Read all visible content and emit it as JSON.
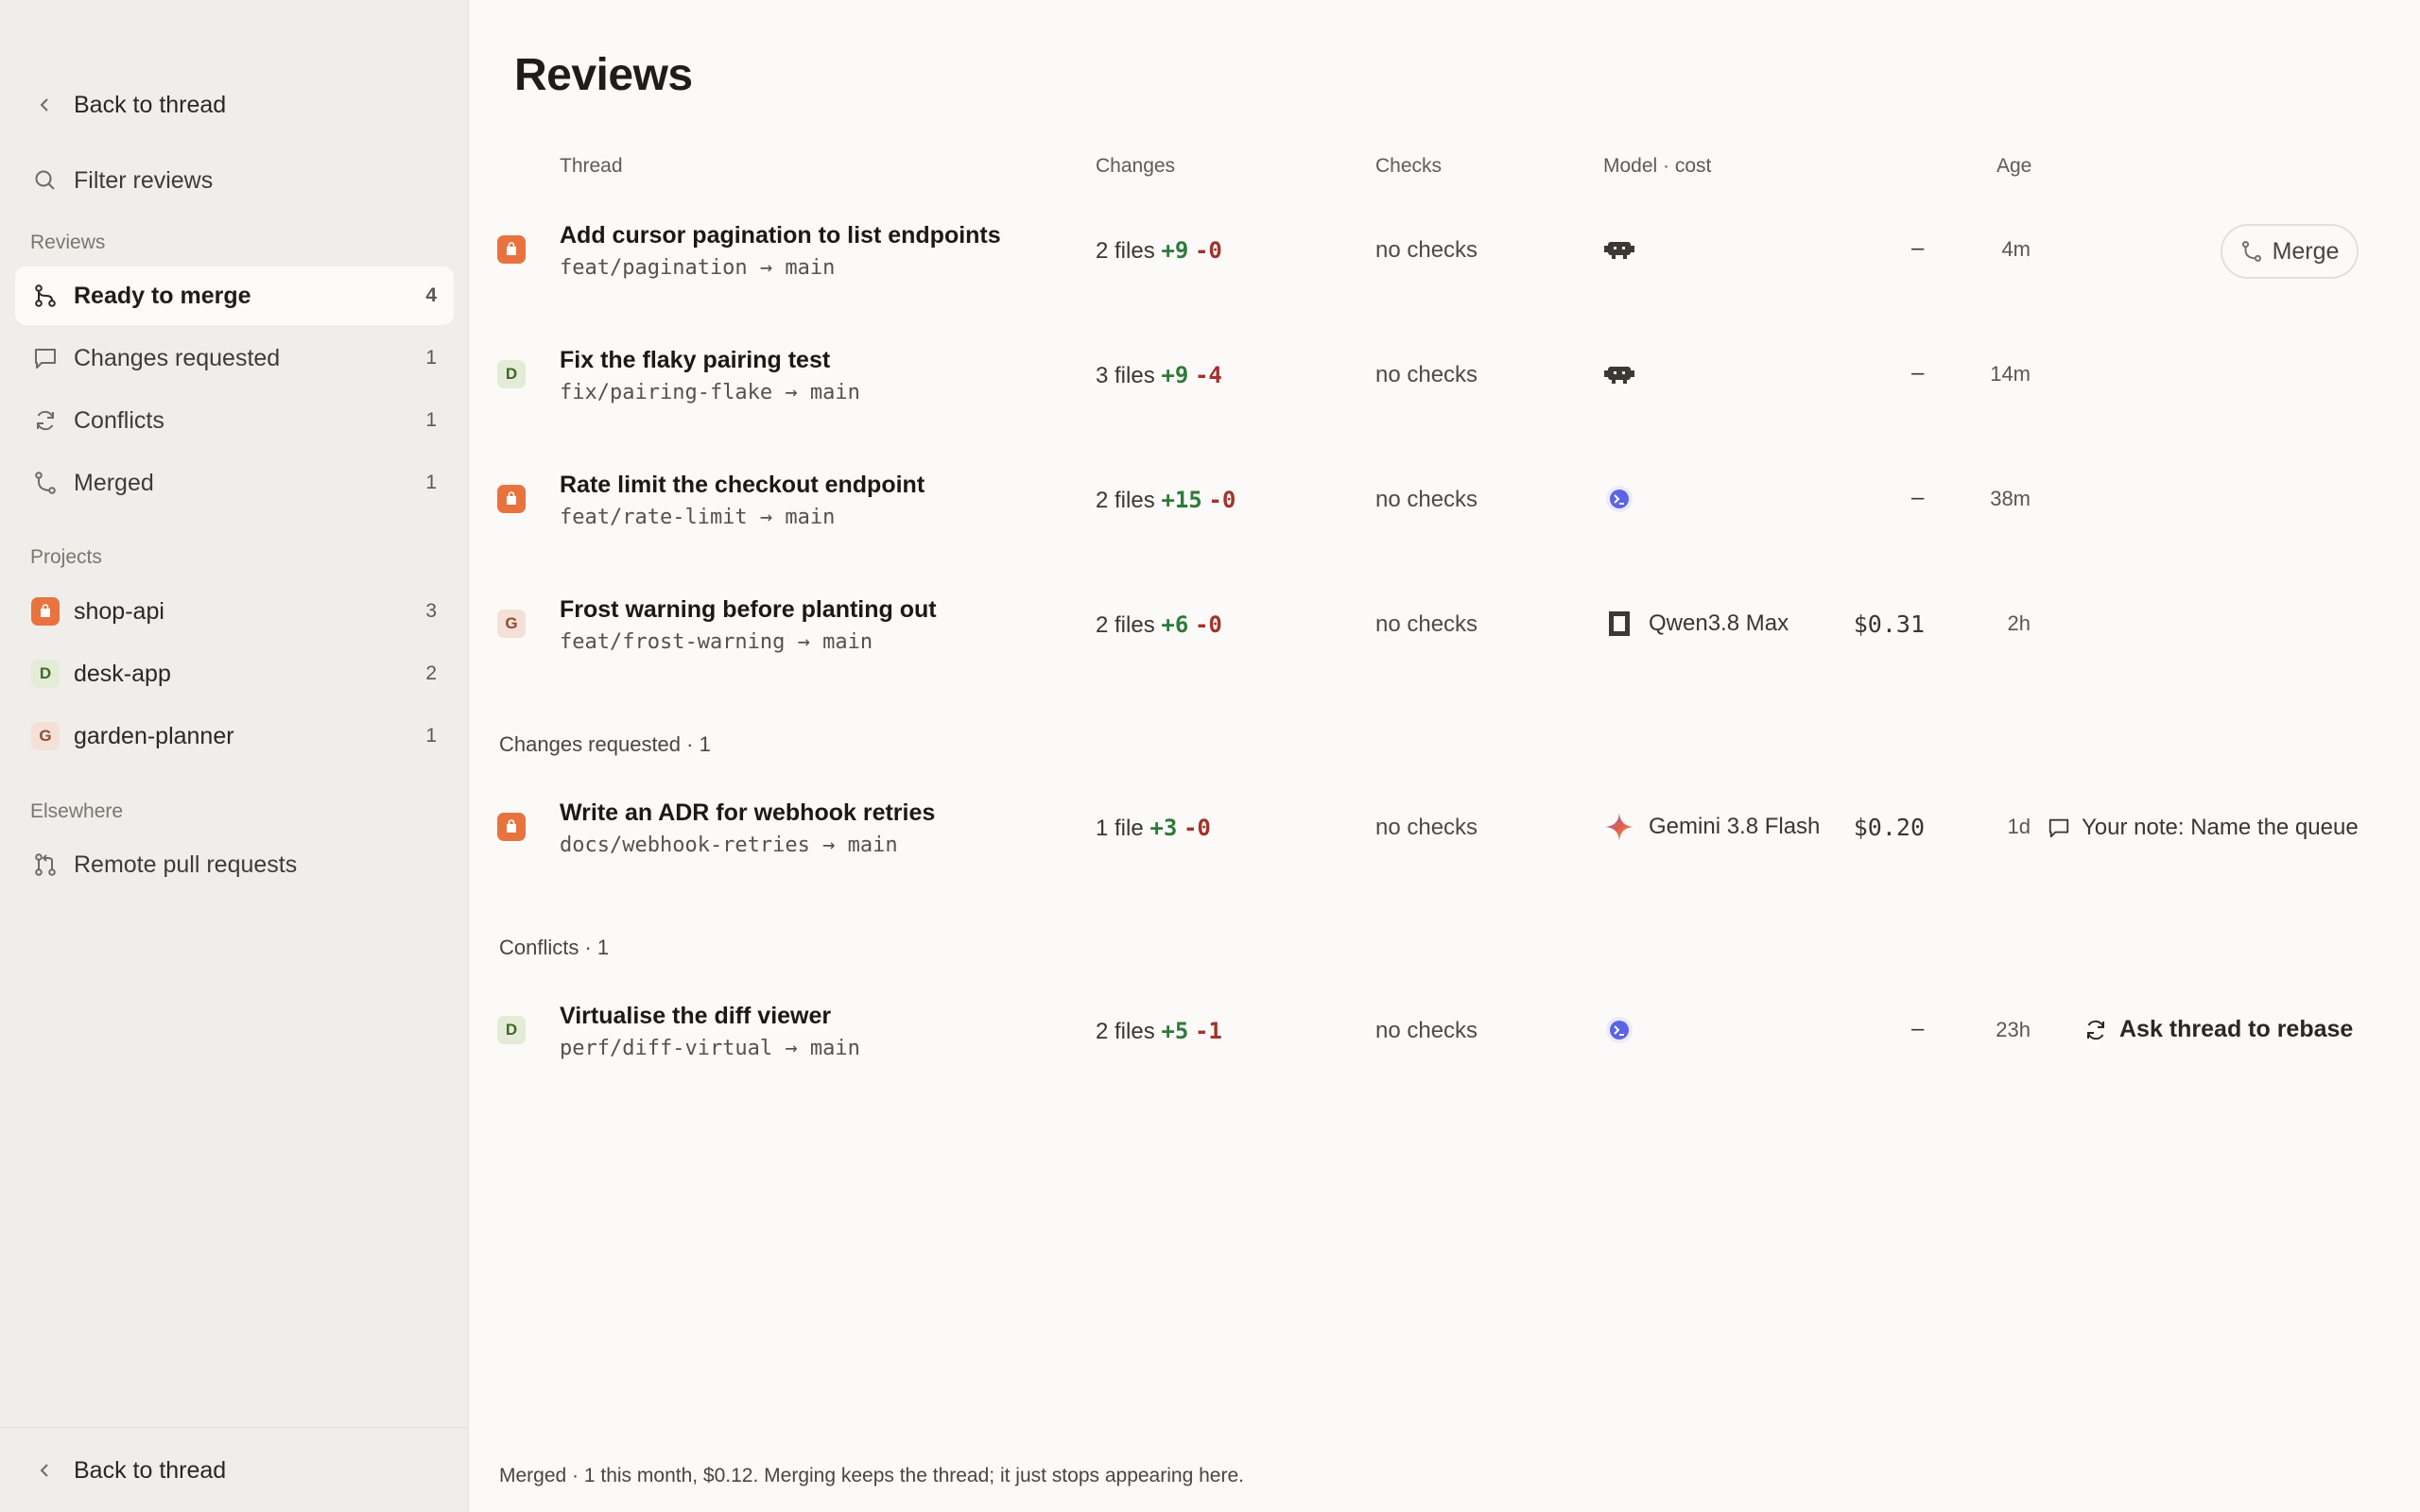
{
  "sidebar": {
    "back_label": "Back to thread",
    "filter_placeholder": "Filter reviews",
    "reviews_heading": "Reviews",
    "items": [
      {
        "label": "Ready to merge",
        "count": "4"
      },
      {
        "label": "Changes requested",
        "count": "1"
      },
      {
        "label": "Conflicts",
        "count": "1"
      },
      {
        "label": "Merged",
        "count": "1"
      }
    ],
    "projects_heading": "Projects",
    "projects": [
      {
        "label": "shop-api",
        "count": "3",
        "badge": "bag-icon",
        "color": "#e8733f"
      },
      {
        "label": "desk-app",
        "count": "2",
        "badge": "D",
        "color": "#e4ecd8"
      },
      {
        "label": "garden-planner",
        "count": "1",
        "badge": "G",
        "color": "#f4e0d6"
      }
    ],
    "elsewhere_heading": "Elsewhere",
    "remote_label": "Remote pull requests",
    "bottom_back_label": "Back to thread"
  },
  "main": {
    "title": "Reviews",
    "columns": {
      "thread": "Thread",
      "changes": "Changes",
      "checks": "Checks",
      "model": "Model · cost",
      "age": "Age"
    },
    "rows": [
      {
        "title": "Add cursor pagination to list endpoints",
        "branch": "feat/pagination → main",
        "files": "2 files",
        "plus": "+9",
        "minus": "-0",
        "checks": "no checks",
        "model_name": "",
        "model_icon": "robot-icon",
        "cost": "",
        "dash": "–",
        "age": "4m",
        "action": "Merge"
      },
      {
        "title": "Fix the flaky pairing test",
        "branch": "fix/pairing-flake → main",
        "files": "3 files",
        "plus": "+9",
        "minus": "-4",
        "checks": "no checks",
        "model_name": "",
        "model_icon": "robot-icon",
        "cost": "",
        "dash": "–",
        "age": "14m"
      },
      {
        "title": "Rate limit the checkout endpoint",
        "branch": "feat/rate-limit → main",
        "files": "2 files",
        "plus": "+15",
        "minus": "-0",
        "checks": "no checks",
        "model_name": "",
        "model_icon": "terminal-orb-icon",
        "cost": "",
        "dash": "–",
        "age": "38m"
      },
      {
        "title": "Frost warning before planting out",
        "branch": "feat/frost-warning → main",
        "files": "2 files",
        "plus": "+6",
        "minus": "-0",
        "checks": "no checks",
        "model_name": "Qwen3.8 Max",
        "model_icon": "square-icon",
        "cost": "$0.31",
        "age": "2h"
      }
    ],
    "group_changes": "Changes requested · 1",
    "changes_rows": [
      {
        "title": "Write an ADR for webhook retries",
        "branch": "docs/webhook-retries → main",
        "files": "1 file",
        "plus": "+3",
        "minus": "-0",
        "checks": "no checks",
        "model_name": "Gemini 3.8 Flash",
        "model_icon": "sparkle-icon",
        "cost": "$0.20",
        "age": "1d",
        "note": "Your note: Name the queue"
      }
    ],
    "group_conflicts": "Conflicts · 1",
    "conflict_rows": [
      {
        "title": "Virtualise the diff viewer",
        "branch": "perf/diff-virtual → main",
        "files": "2 files",
        "plus": "+5",
        "minus": "-1",
        "checks": "no checks",
        "model_icon": "terminal-orb-icon",
        "dash": "–",
        "age": "23h",
        "action": "Ask thread to rebase"
      }
    ],
    "footer": "Merged · 1 this month, $0.12. Merging keeps the thread; it just stops appearing here."
  },
  "colors": {
    "orange": "#e8733f",
    "plus": "#2f7a3b",
    "minus": "#a3322a",
    "sidebar_bg": "#f0eeeb",
    "main_bg": "#fbfaf8"
  }
}
